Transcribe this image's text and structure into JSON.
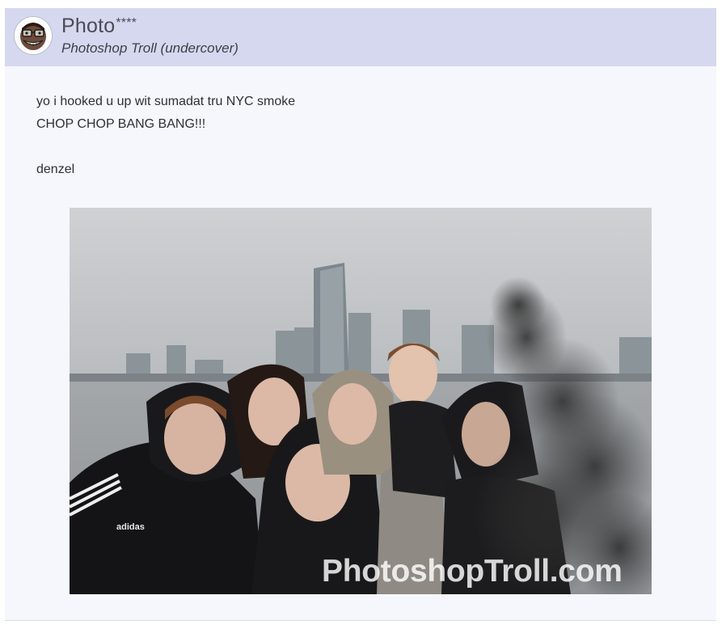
{
  "message": {
    "sender_name": "Photo",
    "sender_mask": "****",
    "sender_subtitle": "Photoshop Troll (undercover)",
    "body_lines": [
      "yo i hooked u up wit sumadat tru NYC smoke",
      "CHOP CHOP BANG BANG!!!",
      "",
      "denzel"
    ],
    "attachment": {
      "watermark": "PhotoshopTroll.com",
      "jacket_brand": "adidas"
    }
  },
  "colors": {
    "header_bg": "#d5d8ef",
    "card_bg": "#f6f7fc",
    "text": "#2f2f35"
  }
}
